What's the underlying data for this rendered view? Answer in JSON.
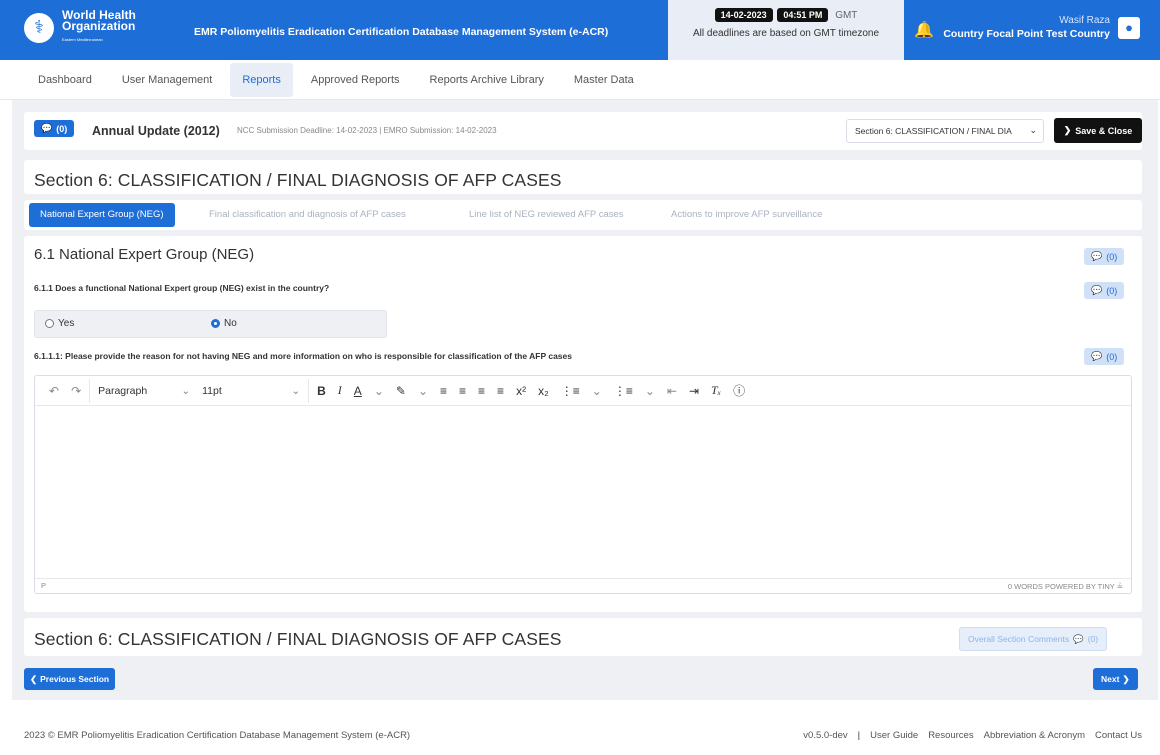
{
  "header": {
    "org_line1": "World Health",
    "org_line2": "Organization",
    "org_line3": "Eastern Mediterranean",
    "app_title": "EMR Poliomyelitis Eradication Certification Database Management System (e-ACR)",
    "date": "14-02-2023",
    "time": "04:51 PM",
    "tz": "GMT",
    "tz_note": "All deadlines are based on GMT timezone",
    "user_name": "Wasif Raza",
    "user_role": "Country Focal Point Test Country",
    "accent": "#1e6ed8"
  },
  "nav": {
    "items": [
      {
        "label": "Dashboard"
      },
      {
        "label": "User Management"
      },
      {
        "label": "Reports"
      },
      {
        "label": "Approved Reports"
      },
      {
        "label": "Reports Archive Library"
      },
      {
        "label": "Master Data"
      }
    ],
    "active": "Reports"
  },
  "report": {
    "comment_count": "(0)",
    "title": "Annual Update (2012)",
    "deadlines": "NCC Submission Deadline: 14-02-2023 | EMRO Submission: 14-02-2023",
    "section_select": "Section 6: CLASSIFICATION / FINAL DIA",
    "save_label": "Save & Close"
  },
  "section": {
    "title": "Section 6: CLASSIFICATION / FINAL DIAGNOSIS OF AFP CASES",
    "tabs": [
      {
        "label": "National Expert Group (NEG)"
      },
      {
        "label": "Final classification and diagnosis of AFP cases"
      },
      {
        "label": "Line list of NEG reviewed AFP cases"
      },
      {
        "label": "Actions to improve AFP surveillance"
      }
    ],
    "active_tab": "National Expert Group (NEG)"
  },
  "subsection": {
    "title": "6.1 National Expert Group (NEG)",
    "comment_count": "(0)",
    "q1": "6.1.1 Does a functional National Expert group (NEG) exist in the country?",
    "q1_comment_count": "(0)",
    "opt_yes": "Yes",
    "opt_no": "No",
    "selected": "No",
    "q2": "6.1.1.1: Please provide the reason for not having NEG and more information on who is responsible for classification of the AFP cases",
    "q2_comment_count": "(0)"
  },
  "editor": {
    "block_format": "Paragraph",
    "font_size": "11pt",
    "path": "P",
    "word_count": "0 WORDS",
    "powered": "POWERED BY TINY"
  },
  "footer_section": {
    "title": "Section 6: CLASSIFICATION / FINAL DIAGNOSIS OF AFP CASES",
    "overall_label": "Overall Section Comments",
    "overall_count": "(0)"
  },
  "pager": {
    "prev": "Previous Section",
    "next": "Next"
  },
  "footer": {
    "copyright": "2023 © EMR Poliomyelitis Eradication Certification Database Management System (e-ACR)",
    "version": "v0.5.0-dev",
    "sep": "|",
    "links": [
      "User Guide",
      "Resources",
      "Abbreviation & Acronym",
      "Contact Us"
    ]
  }
}
